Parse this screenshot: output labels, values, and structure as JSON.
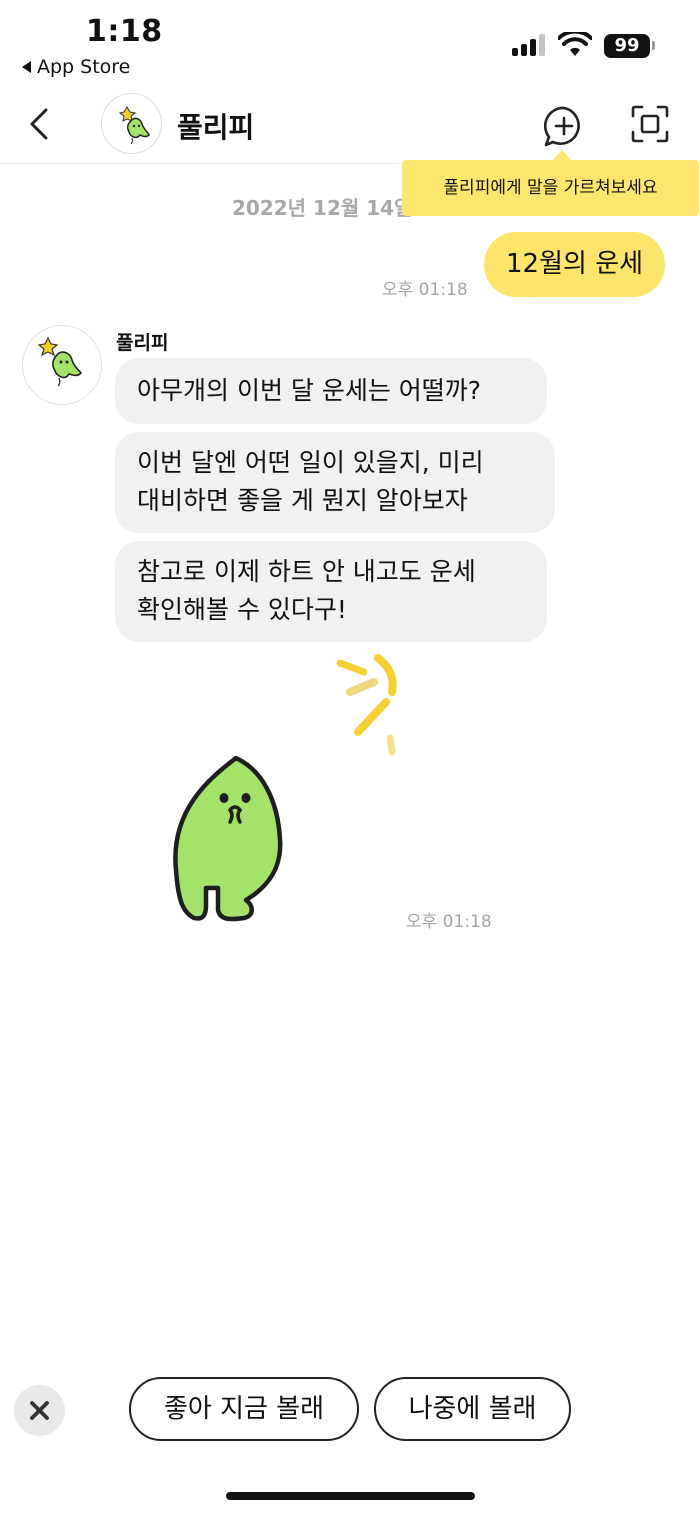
{
  "status_bar": {
    "time": "1:18",
    "back_app": "App Store",
    "battery": "99",
    "signal_icon": "cellular-signal-icon",
    "wifi_icon": "wifi-icon"
  },
  "header": {
    "title": "풀리피",
    "back_icon": "chevron-left-icon",
    "add_icon": "chat-plus-icon",
    "scan_icon": "scan-icon"
  },
  "tooltip": {
    "text": "풀리피에게 말을 가르쳐보세요"
  },
  "chat": {
    "date_separator": "2022년 12월 14일",
    "messages": [
      {
        "from": "me",
        "text": "12월의 운세",
        "time": "오후 01:18"
      },
      {
        "from": "bot",
        "sender": "풀리피",
        "text": "아무개의 이번 달 운세는 어떨까?"
      },
      {
        "from": "bot",
        "text": "이번 달엔 어떤 일이 있을지, 미리\n대비하면 좋을 게 뭔지 알아보자"
      },
      {
        "from": "bot",
        "text": "참고로 이제 하트 안 내고도 운세\n확인해볼 수 있다구!"
      },
      {
        "from": "bot",
        "type": "sticker",
        "sticker": "green-leaf-character",
        "time": "오후 01:18"
      }
    ]
  },
  "actions": {
    "close_icon": "close-icon",
    "primary": "좋아 지금 볼래",
    "secondary": "나중에 볼래"
  },
  "colors": {
    "my_bubble": "#fde46b",
    "bot_bubble": "#f0f1f1",
    "tooltip": "#fce66d",
    "character_green": "#a4e36a"
  }
}
